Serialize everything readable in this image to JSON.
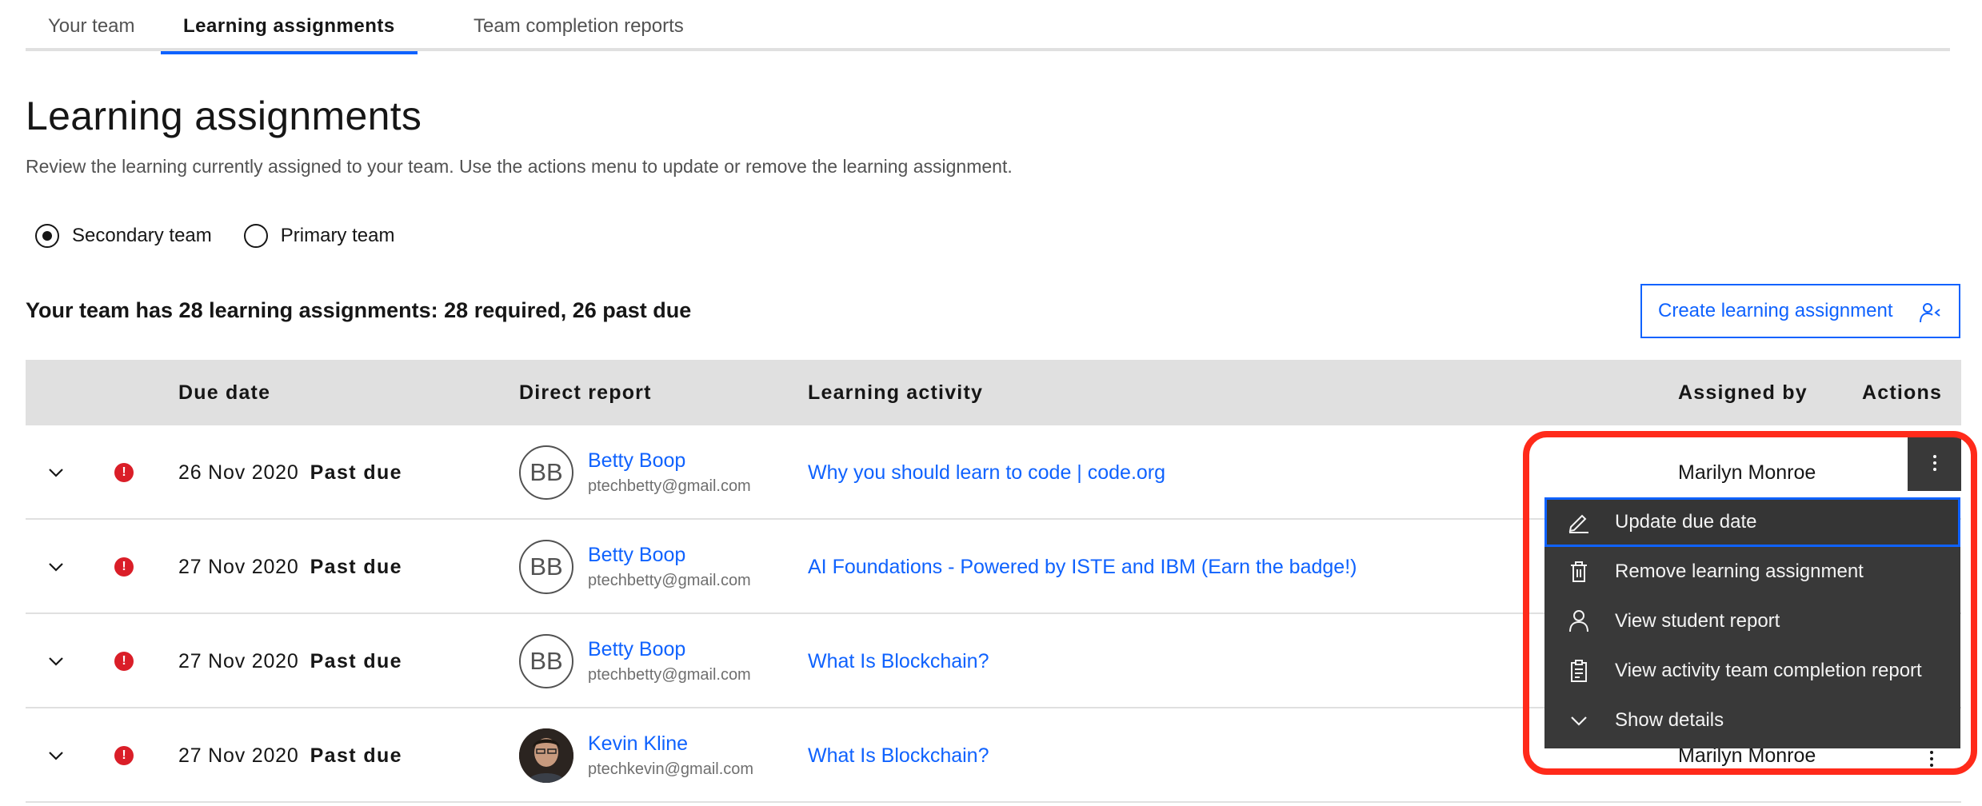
{
  "tabs": [
    {
      "label": "Your team",
      "active": false
    },
    {
      "label": "Learning assignments",
      "active": true
    },
    {
      "label": "Team completion reports",
      "active": false
    }
  ],
  "page": {
    "title": "Learning assignments",
    "description": "Review the learning currently assigned to your team. Use the actions menu to update or remove the learning assignment."
  },
  "team_radio": {
    "options": [
      {
        "label": "Secondary team",
        "checked": true
      },
      {
        "label": "Primary team",
        "checked": false
      }
    ]
  },
  "summary": "Your team has 28 learning assignments: 28 required, 26 past due",
  "create_button": {
    "label": "Create learning assignment",
    "icon": "user-add-icon"
  },
  "table": {
    "headers": {
      "due_date": "Due date",
      "direct_report": "Direct report",
      "learning_activity": "Learning activity",
      "assigned_by": "Assigned by",
      "actions": "Actions"
    },
    "rows": [
      {
        "due_date": "26 Nov 2020",
        "status": "Past due",
        "initials": "BB",
        "name": "Betty Boop",
        "email": "ptechbetty@gmail.com",
        "activity": "Why you should learn to code | code.org",
        "assigned_by": "Marilyn Monroe"
      },
      {
        "due_date": "27 Nov 2020",
        "status": "Past due",
        "initials": "BB",
        "name": "Betty Boop",
        "email": "ptechbetty@gmail.com",
        "activity": "AI Foundations - Powered by ISTE and IBM (Earn the badge!)",
        "assigned_by": ""
      },
      {
        "due_date": "27 Nov 2020",
        "status": "Past due",
        "initials": "BB",
        "name": "Betty Boop",
        "email": "ptechbetty@gmail.com",
        "activity": "What Is Blockchain?",
        "assigned_by": ""
      },
      {
        "due_date": "27 Nov 2020",
        "status": "Past due",
        "initials": "",
        "name": "Kevin Kline",
        "email": "ptechkevin@gmail.com",
        "activity": "What Is Blockchain?",
        "assigned_by": "Marilyn Monroe"
      }
    ]
  },
  "actions_menu": {
    "items": [
      {
        "label": "Update due date",
        "icon": "edit-icon"
      },
      {
        "label": "Remove learning assignment",
        "icon": "trash-icon"
      },
      {
        "label": "View student report",
        "icon": "user-icon"
      },
      {
        "label": "View activity team completion report",
        "icon": "report-icon"
      },
      {
        "label": "Show details",
        "icon": "chevron-down-icon"
      }
    ]
  },
  "colors": {
    "link": "#0f62fe",
    "alert": "#da1e28",
    "menu_bg": "#393939",
    "highlight": "#ff2a1a",
    "header_bg": "#e0e0e0"
  }
}
